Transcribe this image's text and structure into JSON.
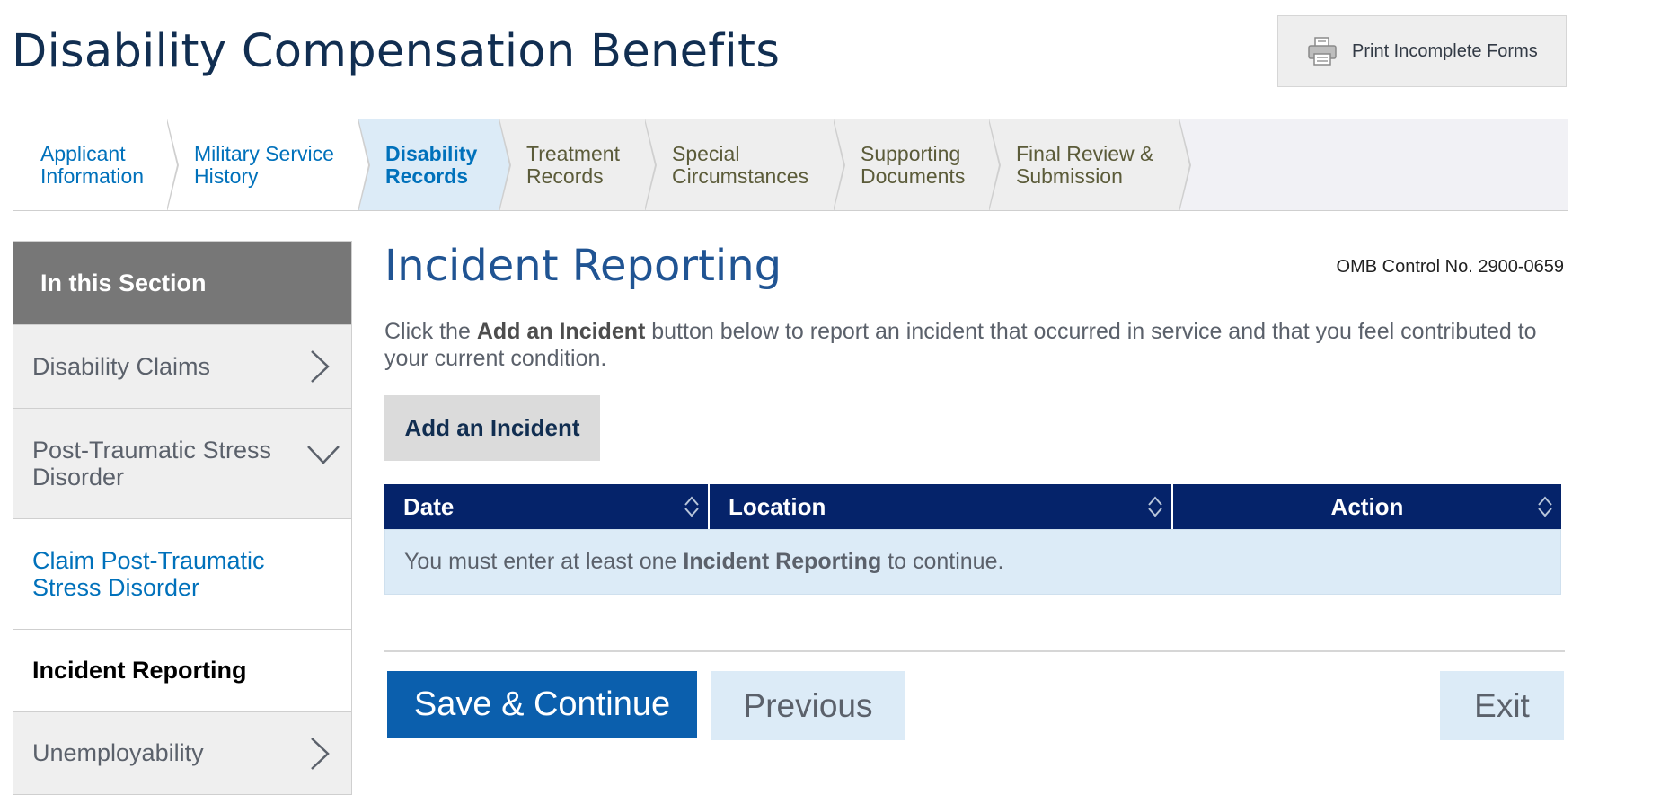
{
  "page": {
    "title": "Disability Compensation Benefits",
    "print_button": "Print Incomplete Forms",
    "print_icon": "printer-icon"
  },
  "steps": [
    {
      "line1": "Applicant",
      "line2": "Information",
      "state": "done"
    },
    {
      "line1": "Military Service",
      "line2": "History",
      "state": "done"
    },
    {
      "line1": "Disability",
      "line2": "Records",
      "state": "active"
    },
    {
      "line1": "Treatment",
      "line2": "Records",
      "state": "todo"
    },
    {
      "line1": "Special",
      "line2": "Circumstances",
      "state": "todo"
    },
    {
      "line1": "Supporting",
      "line2": "Documents",
      "state": "todo"
    },
    {
      "line1": "Final Review &",
      "line2": "Submission",
      "state": "todo"
    }
  ],
  "sidenav": {
    "heading": "In this Section",
    "items": [
      {
        "label": "Disability Claims",
        "icon": "chevron-right-icon"
      },
      {
        "line1": "Post-Traumatic Stress",
        "line2": "Disorder",
        "icon": "chevron-down-icon"
      },
      {
        "line1": "Claim Post-Traumatic",
        "line2": "Stress Disorder"
      },
      {
        "label": "Incident Reporting"
      },
      {
        "label": "Unemployability",
        "icon": "chevron-right-icon"
      }
    ]
  },
  "main": {
    "title": "Incident Reporting",
    "omb": "OMB Control No. 2900-0659",
    "intro_pre": "Click the ",
    "intro_bold": "Add an Incident",
    "intro_post": " button below to report an incident that occurred in service and that you feel contributed to your current condition.",
    "add_button": "Add an Incident"
  },
  "table": {
    "columns": [
      "Date",
      "Location",
      "Action"
    ],
    "sort_icon": "sort-icon",
    "empty_pre": "You must enter at least one ",
    "empty_bold": "Incident Reporting",
    "empty_post": " to continue."
  },
  "footer": {
    "save": "Save & Continue",
    "previous": "Previous",
    "exit": "Exit"
  },
  "colors": {
    "brand_blue": "#0071bb",
    "title_navy": "#112e51",
    "table_header": "#05236a",
    "primary_button": "#0b5fad",
    "light_blue": "#dcebf7"
  }
}
